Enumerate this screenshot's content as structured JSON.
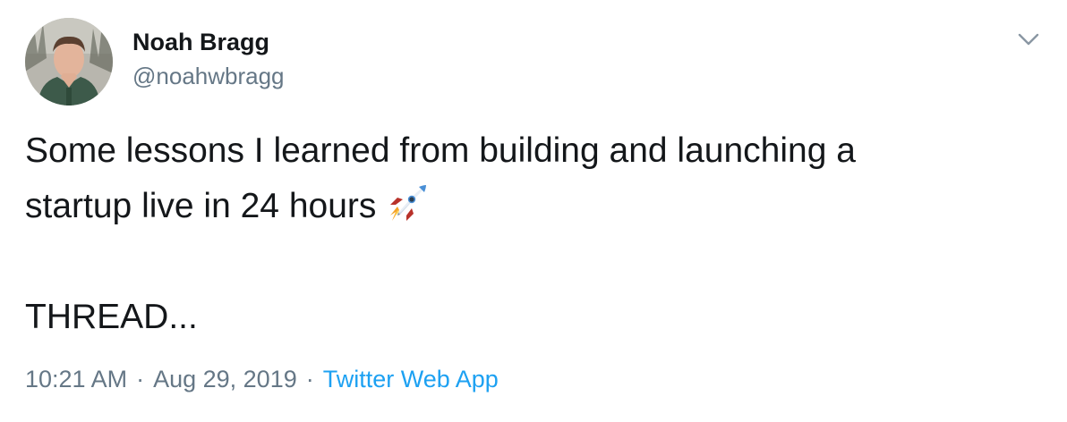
{
  "author": {
    "display_name": "Noah Bragg",
    "handle": "@noahwbragg",
    "avatar_icon": "profile-photo"
  },
  "tweet": {
    "line1": "Some lessons I learned from building and launching a",
    "line2": "startup live in 24 hours",
    "emoji": "rocket-icon",
    "line3": "THREAD..."
  },
  "meta": {
    "time": "10:21 AM",
    "separator": "·",
    "date": "Aug 29, 2019",
    "source": "Twitter Web App"
  },
  "menu_icon": "chevron-down-icon",
  "colors": {
    "text": "#14171a",
    "secondary": "#657786",
    "link": "#1da1f2"
  }
}
